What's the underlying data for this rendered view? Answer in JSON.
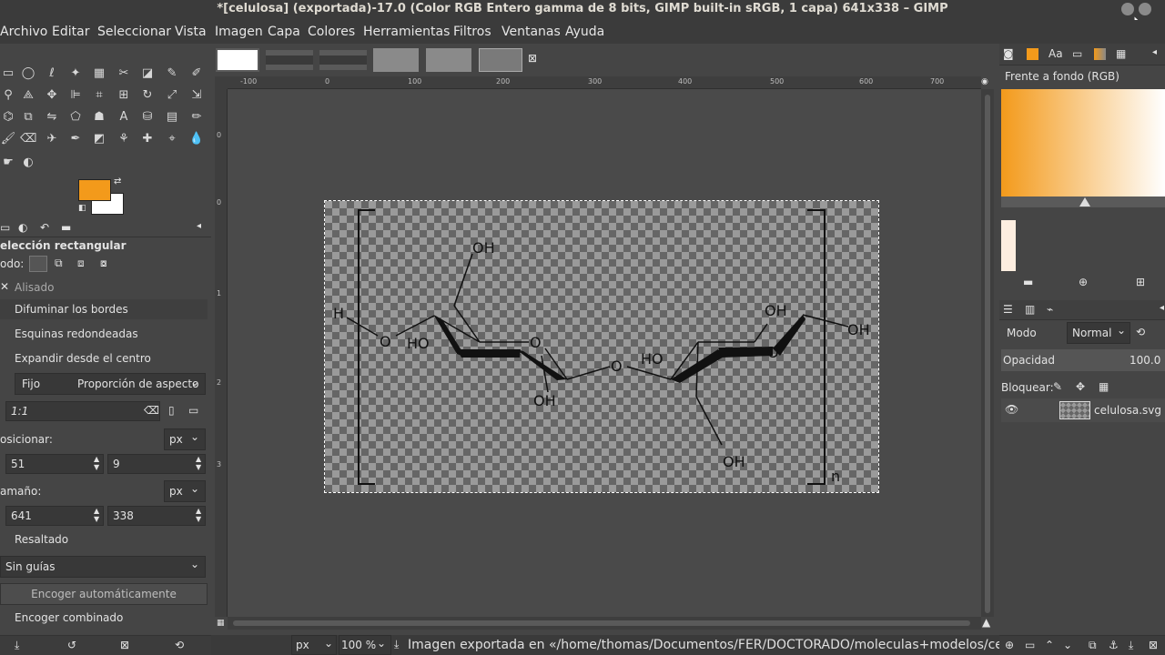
{
  "window": {
    "title": "*[celulosa] (exportada)-17.0 (Color RGB Entero gamma de 8 bits, GIMP built-in sRGB, 1 capa) 641x338 – GIMP"
  },
  "menu": [
    "Archivo",
    "Editar",
    "Seleccionar",
    "Vista",
    "Imagen",
    "Capa",
    "Colores",
    "Herramientas",
    "Filtros",
    "Ventanas",
    "Ayuda"
  ],
  "colors": {
    "foreground": "#f39a1b",
    "background": "#ffffff"
  },
  "tool_options": {
    "title": "elección rectangular",
    "mode_label": "odo:",
    "antialias": "Alisado",
    "feather": "Difuminar los bordes",
    "rounded": "Esquinas redondeadas",
    "expand": "Expandir desde el centro",
    "fixed": "Fijo",
    "fixed_option": "Proporción de aspecto",
    "ratio": "1:1",
    "position_label": "osicionar:",
    "position_unit": "px",
    "pos_x": "51",
    "pos_y": "9",
    "size_label": "amaño:",
    "size_unit": "px",
    "width": "641",
    "height": "338",
    "highlight": "Resaltado",
    "guides": "Sin guías",
    "shrink_button": "Encoger automáticamente",
    "shrink_merged": "Encoger combinado"
  },
  "rulers": {
    "top": [
      "-100",
      "0",
      "100",
      "200",
      "300",
      "400",
      "500",
      "600",
      "700"
    ],
    "left": [
      "0",
      "0",
      "1",
      "2",
      "3"
    ]
  },
  "molecule": {
    "h": "H",
    "o_left": "O",
    "ho_left": "HO",
    "oh_top": "OH",
    "o_ring1": "O",
    "oh_bottom1": "OH",
    "o_bridge": "O",
    "ho_right": "HO",
    "oh_top2": "OH",
    "oh_right": "OH",
    "o_ring2": "O",
    "oh_bottom2": "OH",
    "n": "n"
  },
  "status": {
    "unit": "px",
    "zoom": "100 %",
    "message": "Imagen exportada en «/home/thomas/Documentos/FER/DOCTORADO/moleculas+modelos/celulo..."
  },
  "right_panel": {
    "gradient_label": "Frente a fondo (RGB)",
    "mode_label": "Modo",
    "mode_value": "Normal",
    "opacity_label": "Opacidad",
    "opacity_value": "100.0",
    "lock_label": "Bloquear:",
    "layer_name": "celulosa.svg"
  }
}
